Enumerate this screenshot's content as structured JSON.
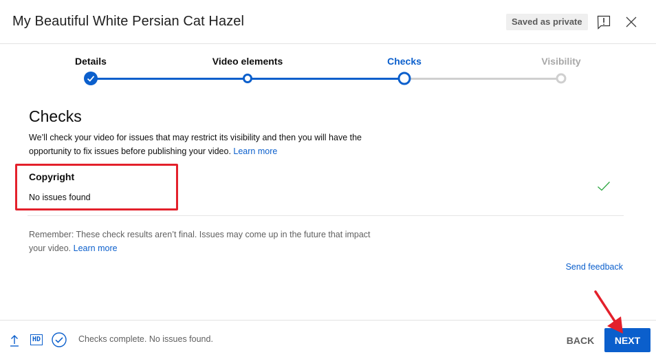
{
  "header": {
    "title": "My Beautiful White Persian Cat Hazel",
    "saved_badge": "Saved as private",
    "feedback_icon": "report-feedback-icon",
    "close_icon": "close-icon"
  },
  "stepper": {
    "steps": [
      {
        "label": "Details",
        "state": "done"
      },
      {
        "label": "Video elements",
        "state": "done"
      },
      {
        "label": "Checks",
        "state": "active"
      },
      {
        "label": "Visibility",
        "state": "todo"
      }
    ]
  },
  "main": {
    "title": "Checks",
    "description": "We’ll check your video for issues that may restrict its visibility and then you will have the opportunity to fix issues before publishing your video.",
    "learn_more": "Learn more",
    "checks": [
      {
        "title": "Copyright",
        "status": "No issues found",
        "icon": "check-icon"
      }
    ],
    "reminder": "Remember: These check results aren’t final. Issues may come up in the future that impact your video.",
    "reminder_learn_more": "Learn more",
    "send_feedback": "Send feedback"
  },
  "footer": {
    "hd_label": "HD",
    "status": "Checks complete. No issues found.",
    "back_label": "BACK",
    "next_label": "NEXT"
  },
  "colors": {
    "accent": "#0b5fcc",
    "success": "#2ba640",
    "highlight": "#e3202b",
    "muted": "#606060"
  }
}
